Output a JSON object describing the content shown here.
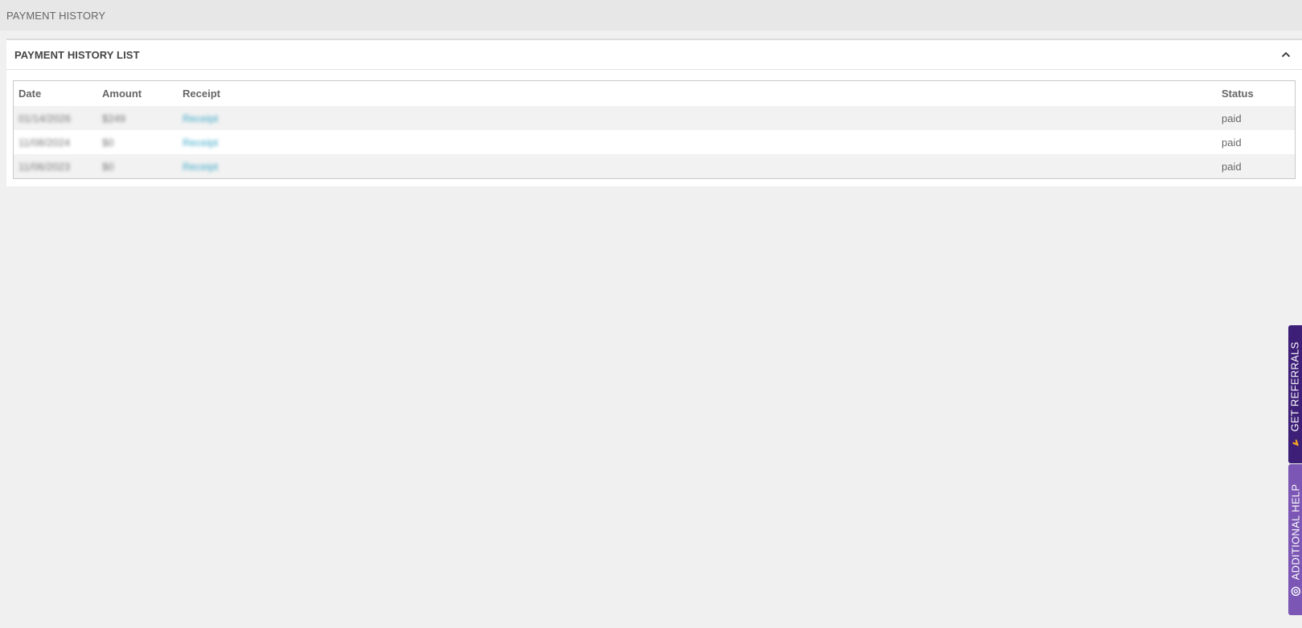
{
  "page": {
    "title": "PAYMENT HISTORY"
  },
  "panel": {
    "title": "PAYMENT HISTORY LIST"
  },
  "table": {
    "headers": {
      "date": "Date",
      "amount": "Amount",
      "receipt": "Receipt",
      "status": "Status"
    },
    "rows": [
      {
        "date": "01/14/2026",
        "amount": "$249",
        "receipt": "Receipt",
        "status": "paid"
      },
      {
        "date": "11/08/2024",
        "amount": "$0",
        "receipt": "Receipt",
        "status": "paid"
      },
      {
        "date": "11/06/2023",
        "amount": "$0",
        "receipt": "Receipt",
        "status": "paid"
      }
    ]
  },
  "side_tabs": {
    "referrals": {
      "label": "GET REFERRALS",
      "icon": "hand-icon",
      "color": "#3e1f78"
    },
    "help": {
      "label": "ADDITIONAL HELP",
      "icon": "help-circle-icon",
      "color": "#7b56b5"
    }
  }
}
